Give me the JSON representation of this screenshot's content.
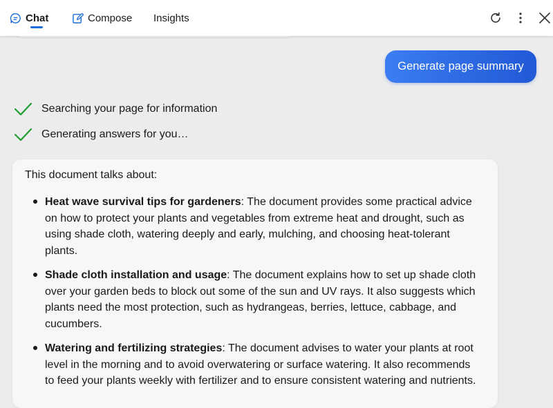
{
  "tabs": [
    {
      "label": "Chat",
      "icon": "chat-bubble-icon",
      "active": true
    },
    {
      "label": "Compose",
      "icon": "compose-icon",
      "active": false
    },
    {
      "label": "Insights",
      "active": false
    }
  ],
  "toolbar": {
    "refresh_icon": "refresh-icon",
    "more_icon": "more-vertical-icon",
    "close_icon": "close-icon"
  },
  "colors": {
    "accent": "#1e6fd9",
    "button_gradient_start": "#3b7df2",
    "button_gradient_end": "#2159d6",
    "check": "#1f9d2f"
  },
  "user_message": {
    "label": "Generate page summary"
  },
  "statuses": [
    {
      "text": "Searching your page for information",
      "icon": "check-icon"
    },
    {
      "text": "Generating answers for you…",
      "icon": "check-icon"
    }
  ],
  "response": {
    "intro": "This document talks about:",
    "bullets": [
      {
        "title": "Heat wave survival tips for gardeners",
        "body": ": The document provides some practical advice on how to protect your plants and vegetables from extreme heat and drought, such as using shade cloth, watering deeply and early, mulching, and choosing heat-tolerant plants."
      },
      {
        "title": "Shade cloth installation and usage",
        "body": ": The document explains how to set up shade cloth over your garden beds to block out some of the sun and UV rays. It also suggests which plants need the most protection, such as hydrangeas, berries, lettuce, cabbage, and cucumbers."
      },
      {
        "title": "Watering and fertilizing strategies",
        "body": ": The document advises to water your plants at root level in the morning and to avoid overwatering or surface watering. It also recommends to feed your plants weekly with fertilizer and to ensure consistent watering and nutrients."
      }
    ]
  }
}
